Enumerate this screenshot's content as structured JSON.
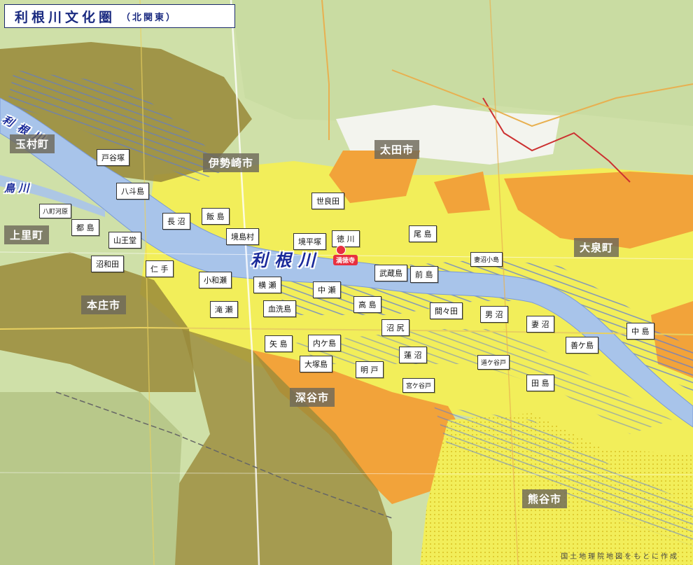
{
  "title": {
    "main": "利根川文化圏",
    "sub": "（北関東）"
  },
  "rivers": {
    "tone": "利根川",
    "tone_upper": "利 根 川",
    "karasu": "鳥 川"
  },
  "cities": {
    "tamamura": "玉村町",
    "kamisato": "上里町",
    "honjo": "本庄市",
    "isesaki": "伊勢崎市",
    "ota": "太田市",
    "oizumi": "大泉町",
    "fukaya": "深谷市",
    "kumagaya": "熊谷市"
  },
  "villages": {
    "toyazuka": "戸谷塚",
    "hattojima": "八斗島",
    "hacchogawara": "八町河原",
    "tojima": "都 島",
    "nagasaki": "長 沼",
    "iijima": "飯 島",
    "sannodo": "山王堂",
    "sakaijimamura": "境島村",
    "numawada": "沼和田",
    "nite": "仁 手",
    "kowase": "小和瀬",
    "yokose": "横 瀬",
    "takise": "滝 瀬",
    "chiarai": "血洗島",
    "serada": "世良田",
    "sakaihiratsuka": "境平塚",
    "tokugawa": "徳 川",
    "ojima": "尾 島",
    "tsumanumakojima": "妻沼小島",
    "musashijima": "武蔵島",
    "maejima": "前 島",
    "nakaze": "中 瀬",
    "takashima": "高 島",
    "mamada": "間々田",
    "onuma": "男 沼",
    "menuma": "妻 沼",
    "nakajima": "中 島",
    "yajima": "矢 島",
    "uchigashima": "内ケ島",
    "numajiri": "沼 尻",
    "hasunuma": "蓮 沼",
    "zengashima": "善ケ島",
    "otsukajima": "大塚島",
    "doganto": "道ケ谷戸",
    "myoto": "明 戸",
    "miyagayato": "宮ケ谷戸",
    "tajima": "田 島"
  },
  "temple": {
    "name": "満徳寺",
    "icon": "temple-marker-icon",
    "color": "#e83040"
  },
  "credit": "国土地理院地図をもとに作成",
  "colors": {
    "river": "#a8c4ea",
    "lowland": "#f2ee5a",
    "terrace": "#f2a33a",
    "upland": "#9a8a3a",
    "hills": "#c4d88a",
    "label_city_bg": "#6e695a",
    "title_text": "#1a2a80"
  }
}
